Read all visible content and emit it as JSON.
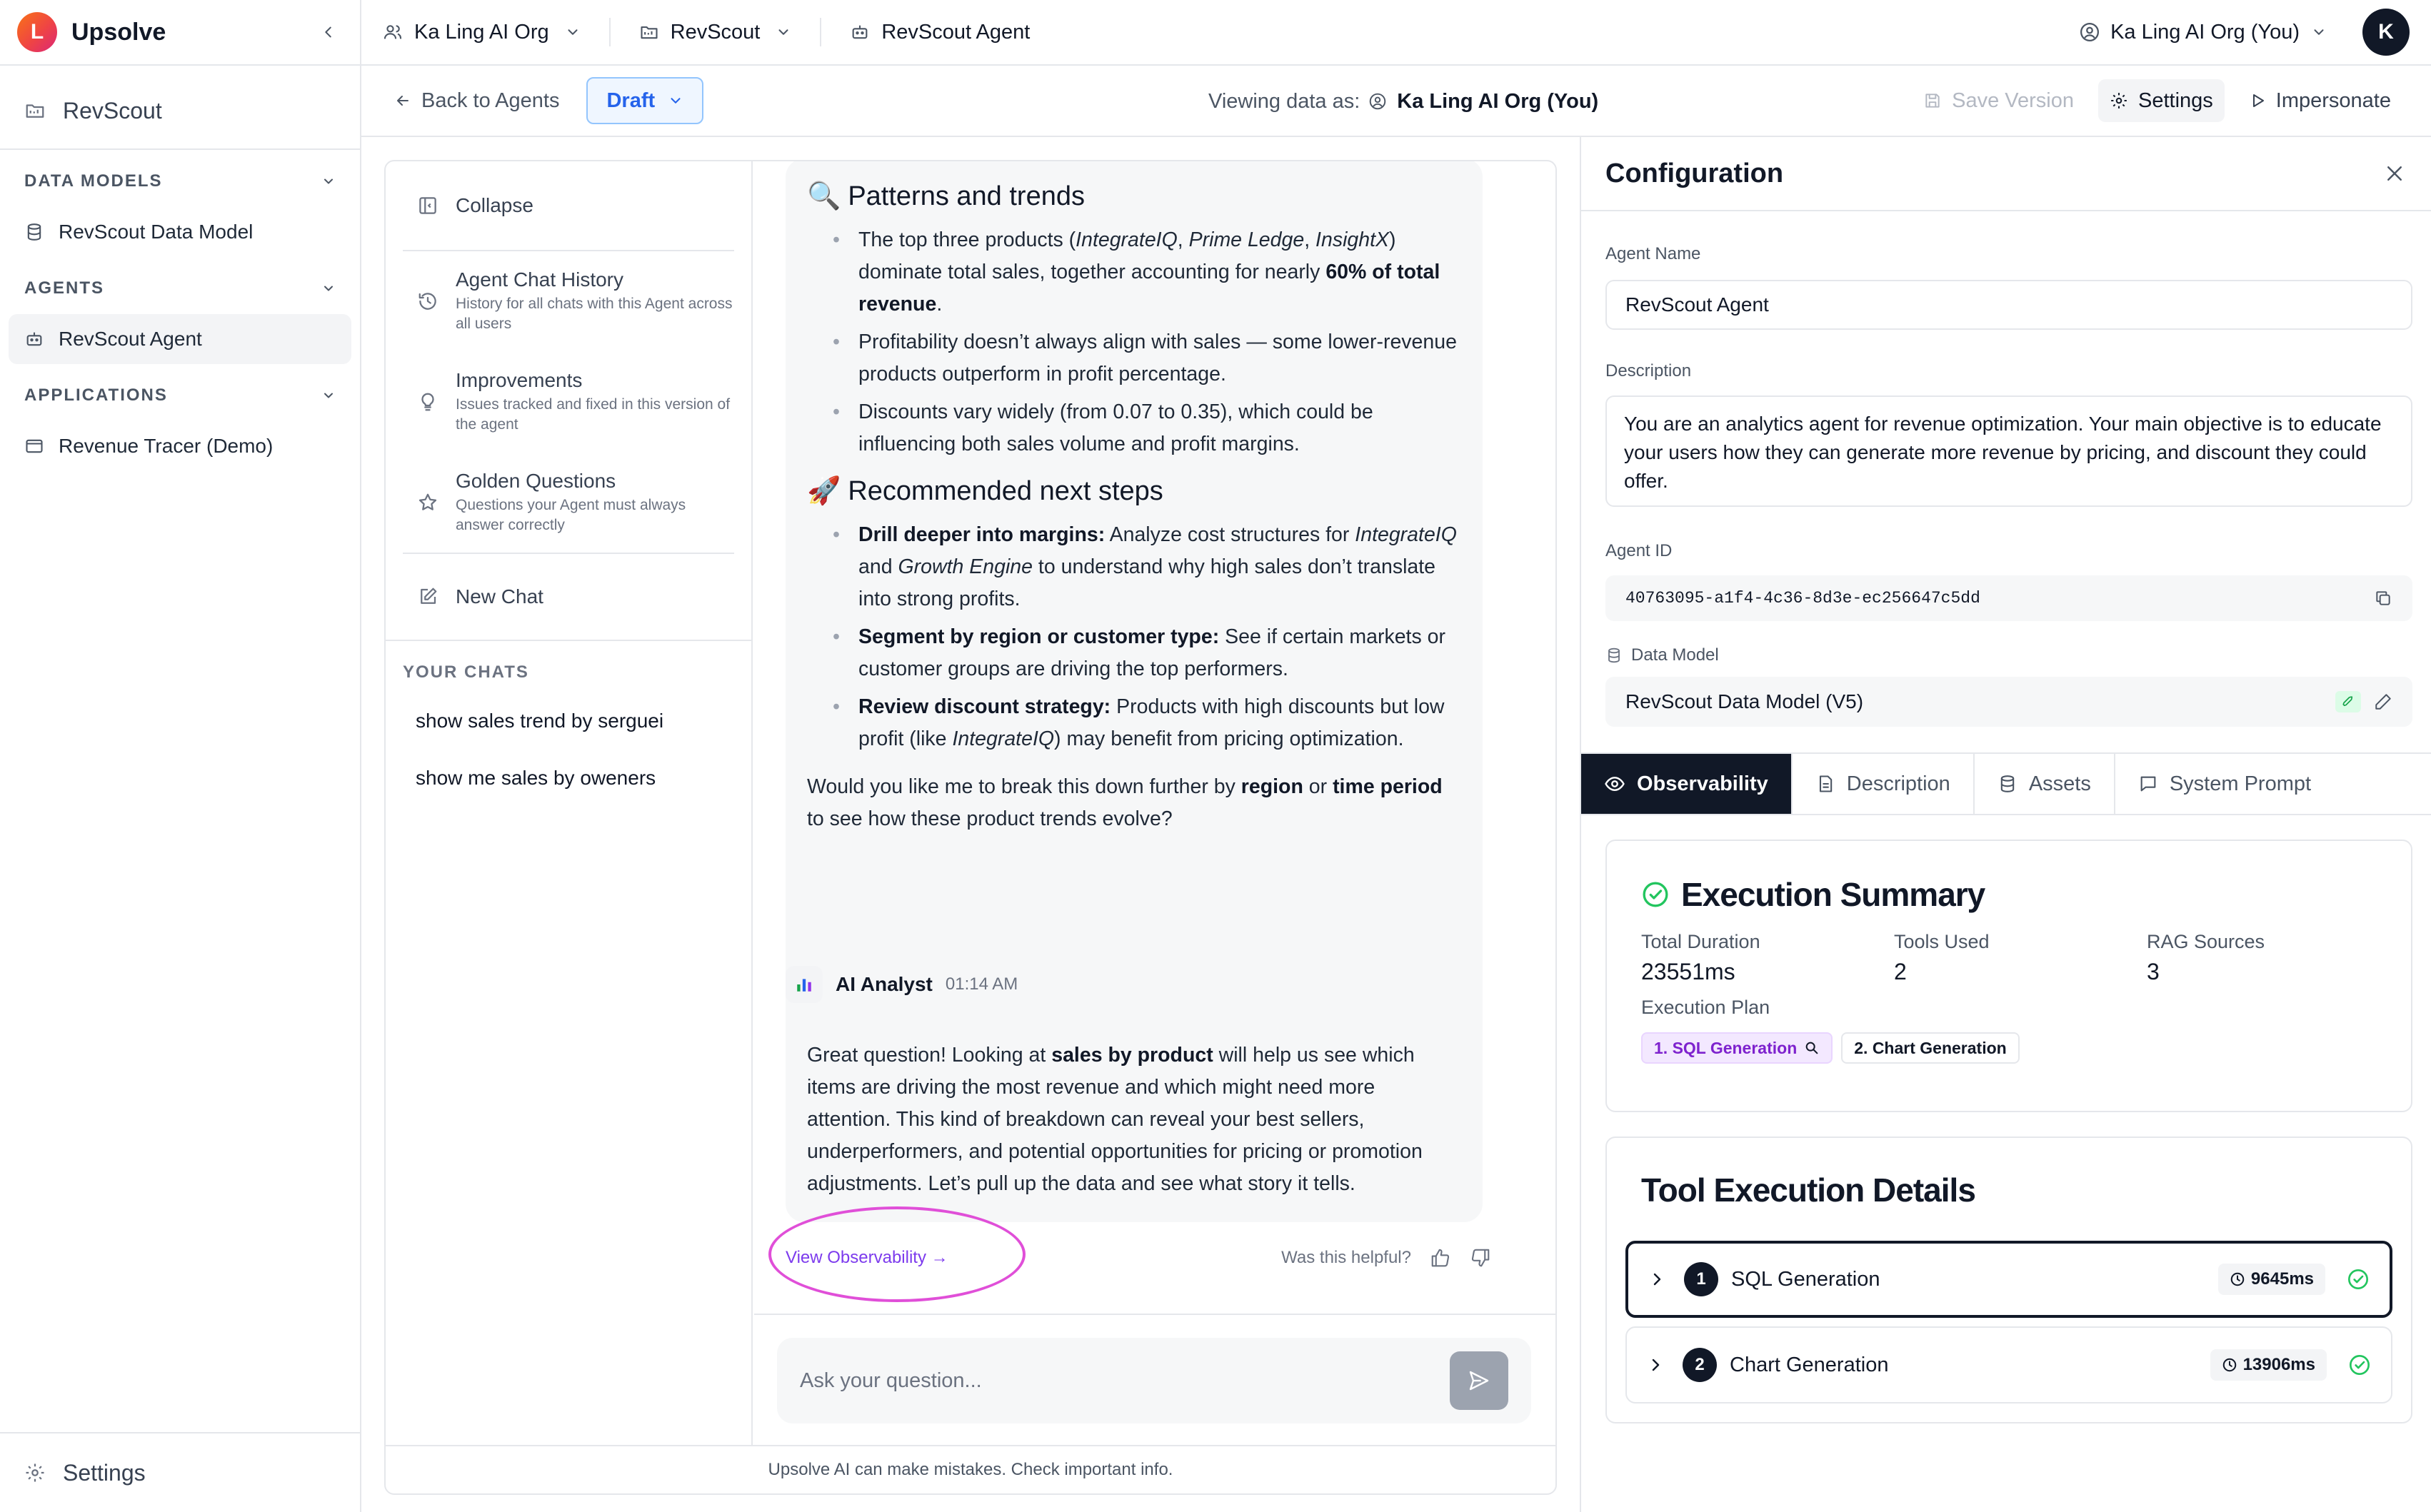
{
  "sidebar": {
    "brand": "Upsolve",
    "logo_letter": "L",
    "workspace": "RevScout",
    "sections": {
      "data_models": {
        "title": "DATA MODELS",
        "items": [
          "RevScout Data Model"
        ]
      },
      "agents": {
        "title": "AGENTS",
        "items": [
          "RevScout Agent"
        ]
      },
      "applications": {
        "title": "APPLICATIONS",
        "items": [
          "Revenue Tracer (Demo)"
        ]
      }
    },
    "settings": "Settings"
  },
  "topbar": {
    "org": "Ka Ling AI Org",
    "workspace": "RevScout",
    "agent": "RevScout Agent",
    "user": "Ka Ling AI Org (You)",
    "avatar": "K"
  },
  "subbar": {
    "back": "Back to Agents",
    "status": "Draft",
    "viewing_label": "Viewing data as:",
    "viewing_user": "Ka Ling AI Org (You)",
    "save": "Save Version",
    "settings": "Settings",
    "impersonate": "Impersonate"
  },
  "chat_nav": {
    "collapse": "Collapse",
    "history_title": "Agent Chat History",
    "history_sub": "History for all chats with this Agent across all users",
    "improvements_title": "Improvements",
    "improvements_sub": "Issues tracked and fixed in this version of the agent",
    "golden_title": "Golden Questions",
    "golden_sub": "Questions your Agent must always answer correctly",
    "new_chat": "New Chat",
    "your_chats": "YOUR CHATS",
    "chats": [
      "show sales trend by serguei",
      "show me sales by oweners"
    ]
  },
  "messages": {
    "m1": {
      "h1_emoji": "🔍",
      "h1": "Patterns and trends",
      "b1_a": "The top three products (",
      "b1_p1": "IntegrateIQ",
      "b1_c1": ", ",
      "b1_p2": "Prime Ledge",
      "b1_c2": ", ",
      "b1_p3": "InsightX",
      "b1_b": ") dominate total sales, together accounting for nearly ",
      "b1_bold": "60% of total revenue",
      "b1_end": ".",
      "b2": "Profitability doesn’t always align with sales — some lower-revenue products outperform in profit percentage.",
      "b3": "Discounts vary widely (from 0.07 to 0.35), which could be influencing both sales volume and profit margins.",
      "h2_emoji": "🚀",
      "h2": "Recommended next steps",
      "s1_bold": "Drill deeper into margins:",
      "s1_a": " Analyze cost structures for ",
      "s1_p1": "IntegrateIQ",
      "s1_b": " and ",
      "s1_p2": "Growth Engine",
      "s1_c": " to understand why high sales don’t translate into strong profits.",
      "s2_bold": "Segment by region or customer type:",
      "s2": " See if certain markets or customer groups are driving the top performers.",
      "s3_bold": "Review discount strategy:",
      "s3_a": " Products with high discounts but low profit (like ",
      "s3_p": "IntegrateIQ",
      "s3_b": ") may benefit from pricing optimization.",
      "q_a": "Would you like me to break this down further by ",
      "q_b1": "region",
      "q_or": " or ",
      "q_b2": "time period",
      "q_end": " to see how these product trends evolve?"
    },
    "m2": {
      "author": "AI Analyst",
      "time": "01:14 AM",
      "a": "Great question! Looking at ",
      "bold": "sales by product",
      "b": " will help us see which items are driving the most revenue and which might need more attention. This kind of breakdown can reveal your best sellers, underperformers, and potential opportunities for pricing or promotion adjustments. Let’s pull up the data and see what story it tells."
    },
    "view_observability": "View Observability →",
    "helpful": "Was this helpful?",
    "input_placeholder": "Ask your question...",
    "disclaimer": "Upsolve AI can make mistakes. Check important info."
  },
  "config": {
    "title": "Configuration",
    "agent_name_label": "Agent Name",
    "agent_name": "RevScout Agent",
    "description_label": "Description",
    "description": "You are an analytics agent for revenue optimization. Your main objective is to educate your users how they can generate more revenue by pricing, and discount they could offer.",
    "agent_id_label": "Agent ID",
    "agent_id": "40763095-a1f4-4c36-8d3e-ec256647c5dd",
    "data_model_label": "Data Model",
    "data_model": "RevScout Data Model (V5)",
    "tabs": [
      "Observability",
      "Description",
      "Assets",
      "System Prompt"
    ],
    "exec_summary": {
      "title": "Execution Summary",
      "total_duration_label": "Total Duration",
      "total_duration": "23551ms",
      "tools_used_label": "Tools Used",
      "tools_used": "2",
      "rag_label": "RAG Sources",
      "rag": "3",
      "plan_label": "Execution Plan",
      "plan": [
        "1. SQL Generation",
        "2. Chart Generation"
      ]
    },
    "tool_details": {
      "title": "Tool Execution Details",
      "tools": [
        {
          "num": "1",
          "name": "SQL Generation",
          "duration": "9645ms"
        },
        {
          "num": "2",
          "name": "Chart Generation",
          "duration": "13906ms"
        }
      ]
    }
  }
}
